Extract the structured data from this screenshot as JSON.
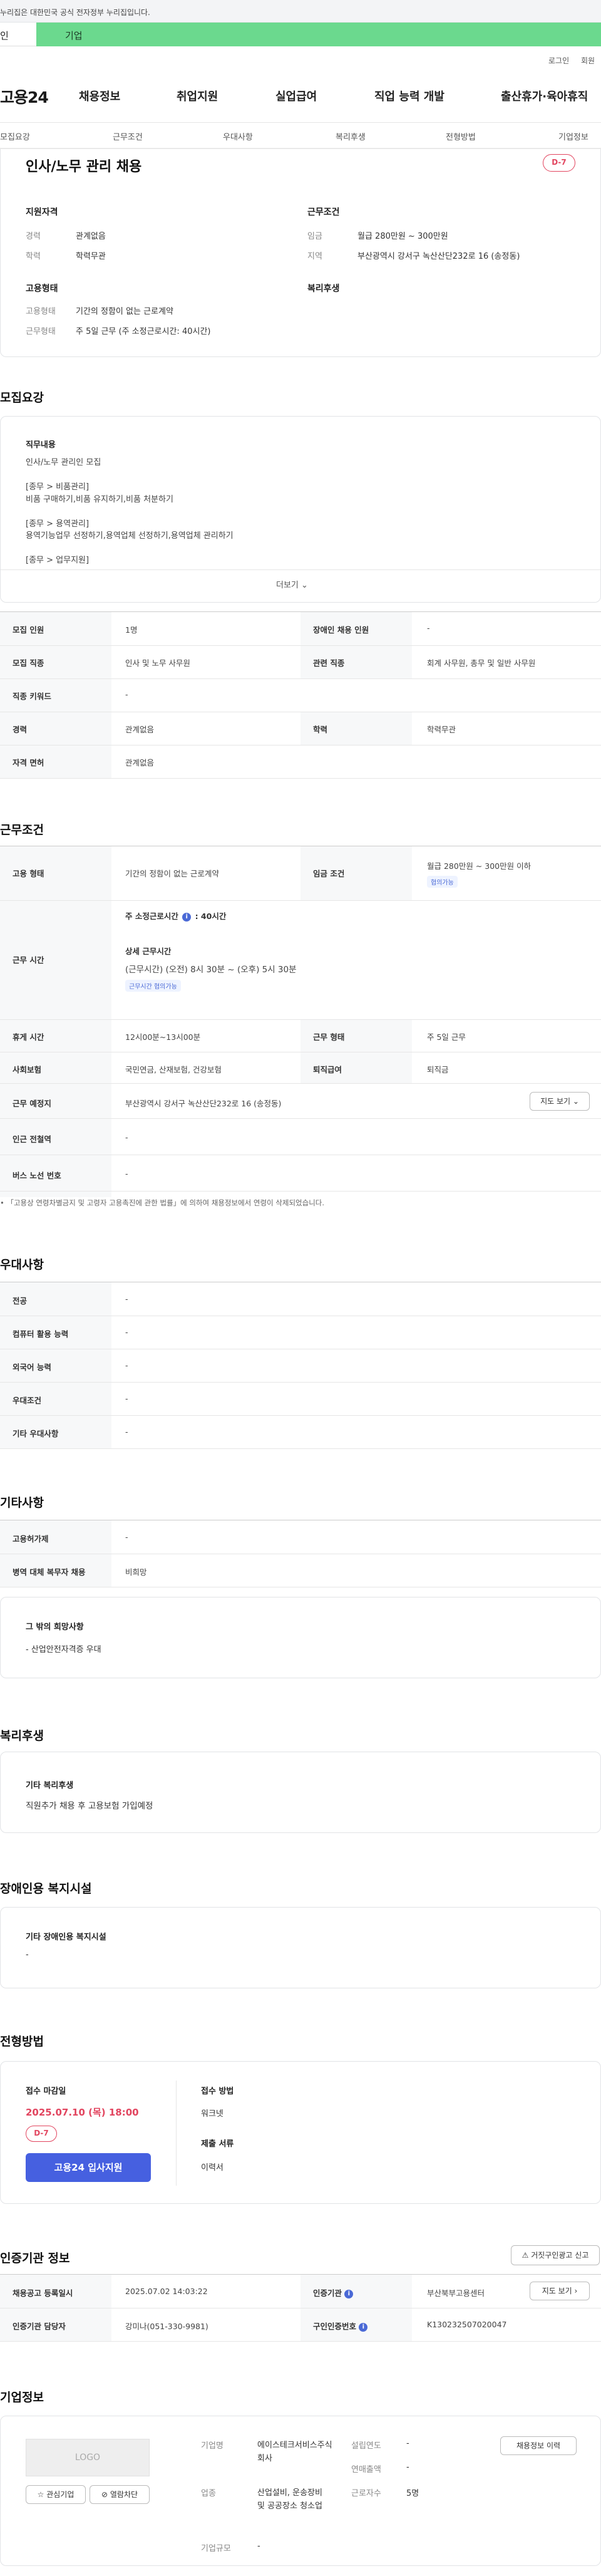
{
  "gov_notice": "누리집은 대한민국 공식 전자정부 누리집입니다.",
  "user_tabs": {
    "personal": "인",
    "company": "기업"
  },
  "util": {
    "login": "로그인",
    "join": "회원"
  },
  "logo": "고용24",
  "gnb": [
    "채용정보",
    "취업지원",
    "실업급여",
    "직업 능력 개발",
    "출산휴가·육아휴직"
  ],
  "subnav": [
    "모집요강",
    "근무조건",
    "우대사항",
    "복리후생",
    "전형방법",
    "기업정보"
  ],
  "summary": {
    "title": "인사/노무 관리 채용",
    "dday": "D-7",
    "qualification": {
      "title": "지원자격",
      "rows": [
        {
          "label": "경력",
          "value": "관계없음"
        },
        {
          "label": "학력",
          "value": "학력무관"
        }
      ]
    },
    "conditions": {
      "title": "근무조건",
      "rows": [
        {
          "label": "임금",
          "value": "월급 280만원 ~ 300만원"
        },
        {
          "label": "지역",
          "value": "부산광역시 강서구 녹산산단232로 16 (송정동)"
        }
      ]
    },
    "employment": {
      "title": "고용형태",
      "rows": [
        {
          "label": "고용형태",
          "value": "기간의 정함이 없는 근로계약"
        },
        {
          "label": "근무형태",
          "value": "주 5일 근무 (주 소정근로시간: 40시간)"
        }
      ]
    },
    "welfare": {
      "title": "복리후생"
    }
  },
  "recruit": {
    "section_title": "모집요강",
    "duty_title": "직무내용",
    "duty_lines": [
      "인사/노무 관리인 모집",
      "",
      "[종무 > 비품관리]",
      "비품 구매하기,비품 유지하기,비품 처분하기",
      "",
      "[종무 > 용역관리]",
      "용역기능업무 선정하기,용역업체 선정하기,용역업체 관리하기",
      "",
      "[종무 > 업무지원]"
    ],
    "more": "더보기",
    "table": [
      {
        "k1": "모집 인원",
        "v1": "1명",
        "k2": "장애인 채용 인원",
        "v2": "-"
      },
      {
        "k1": "모집 직종",
        "v1": "인사 및 노무 사무원",
        "k2": "관련 직종",
        "v2": "회계 사무원, 총무 및 일반 사무원"
      },
      {
        "k1": "직종 키워드",
        "v1": "-"
      },
      {
        "k1": "경력",
        "v1": "관계없음",
        "k2": "학력",
        "v2": "학력무관"
      },
      {
        "k1": "자격 면허",
        "v1": "관계없음"
      }
    ]
  },
  "work": {
    "section_title": "근무조건",
    "employment_type_label": "고용 형태",
    "employment_type": "기간의 정함이 없는 근로계약",
    "wage_label": "임금 조건",
    "wage": "월급 280만원 ~ 300만원 이하",
    "wage_pill": "협의가능",
    "hours_label": "근무 시간",
    "weekly_hours_label": "주 소정근로시간",
    "weekly_hours": "40시간",
    "detail_title": "상세 근무시간",
    "detail": "(근무시간) (오전) 8시 30분 ~ (오후) 5시 30분",
    "detail_pill": "근무시간 협의가능",
    "break_label": "휴게 시간",
    "break_value": "12시00분~13시00분",
    "work_type_label": "근무 형태",
    "work_type": "주 5일 근무",
    "insurance_label": "사회보험",
    "insurance": "국민연금, 산재보험, 건강보험",
    "severance_label": "퇴직급여",
    "severance": "퇴직금",
    "location_label": "근무 예정지",
    "location": "부산광역시 강서구 녹산산단232로 16 (송정동)",
    "map_button": "지도 보기",
    "subway_label": "인근 전철역",
    "subway": "-",
    "bus_label": "버스 노선 번호",
    "bus": "-",
    "note": "「고용상 연령차별금지 및 고령자 고용촉진에 관한 법률」에 의하여 채용정보에서 연령이 삭제되었습니다."
  },
  "pref": {
    "section_title": "우대사항",
    "rows": [
      {
        "k": "전공",
        "v": "-"
      },
      {
        "k": "컴퓨터 활용 능력",
        "v": "-"
      },
      {
        "k": "외국어 능력",
        "v": "-"
      },
      {
        "k": "우대조건",
        "v": "-"
      },
      {
        "k": "기타 우대사항",
        "v": "-"
      }
    ]
  },
  "etc": {
    "section_title": "기타사항",
    "rows": [
      {
        "k": "고용허가제",
        "v": "-"
      },
      {
        "k": "병역 대체 복무자 채용",
        "v": "비희망"
      }
    ],
    "other_title": "그 밖의 희망사항",
    "other_value": "- 산업안전자격증 우대"
  },
  "benefits": {
    "section_title": "복리후생",
    "sub_title": "기타 복리후생",
    "value": "직원추가 채용 후 고용보험 가입예정"
  },
  "disability": {
    "section_title": "장애인용 복지시설",
    "sub_title": "기타 장애인용 복지시설",
    "value": "-"
  },
  "process": {
    "section_title": "전형방법",
    "deadline_label": "접수 마감일",
    "deadline": "2025.07.10 (목) 18:00",
    "dday": "D-7",
    "apply_button": "고용24 입사지원",
    "method_label": "접수 방법",
    "method": "워크넷",
    "docs_label": "제출 서류",
    "docs": "이력서"
  },
  "agency": {
    "section_title": "인증기관 정보",
    "report_button": "거짓구인광고 신고",
    "reg_date_label": "채용공고 등록일시",
    "reg_date": "2025.07.02 14:03:22",
    "agency_label": "인증기관",
    "agency": "부산북부고용센터",
    "map_button": "지도 보기",
    "manager_label": "인증기관 담당자",
    "manager": "강미나(051-330-9981)",
    "number_label": "구인인증번호",
    "number": "K130232507020047"
  },
  "company": {
    "section_title": "기업정보",
    "logo": "LOGO",
    "interest": "관심기업",
    "block": "열람차단",
    "history_button": "채용정보 이력",
    "name_label": "기업명",
    "name": "에이스테크서비스주식회사",
    "industry_label": "업종",
    "industry": "산업설비, 운송장비 및 공공장소 청소업",
    "size_label": "기업규모",
    "size": "-",
    "founded_label": "설립연도",
    "founded": "-",
    "revenue_label": "연매출액",
    "revenue": "-",
    "employees_label": "근로자수",
    "employees": "5명"
  }
}
